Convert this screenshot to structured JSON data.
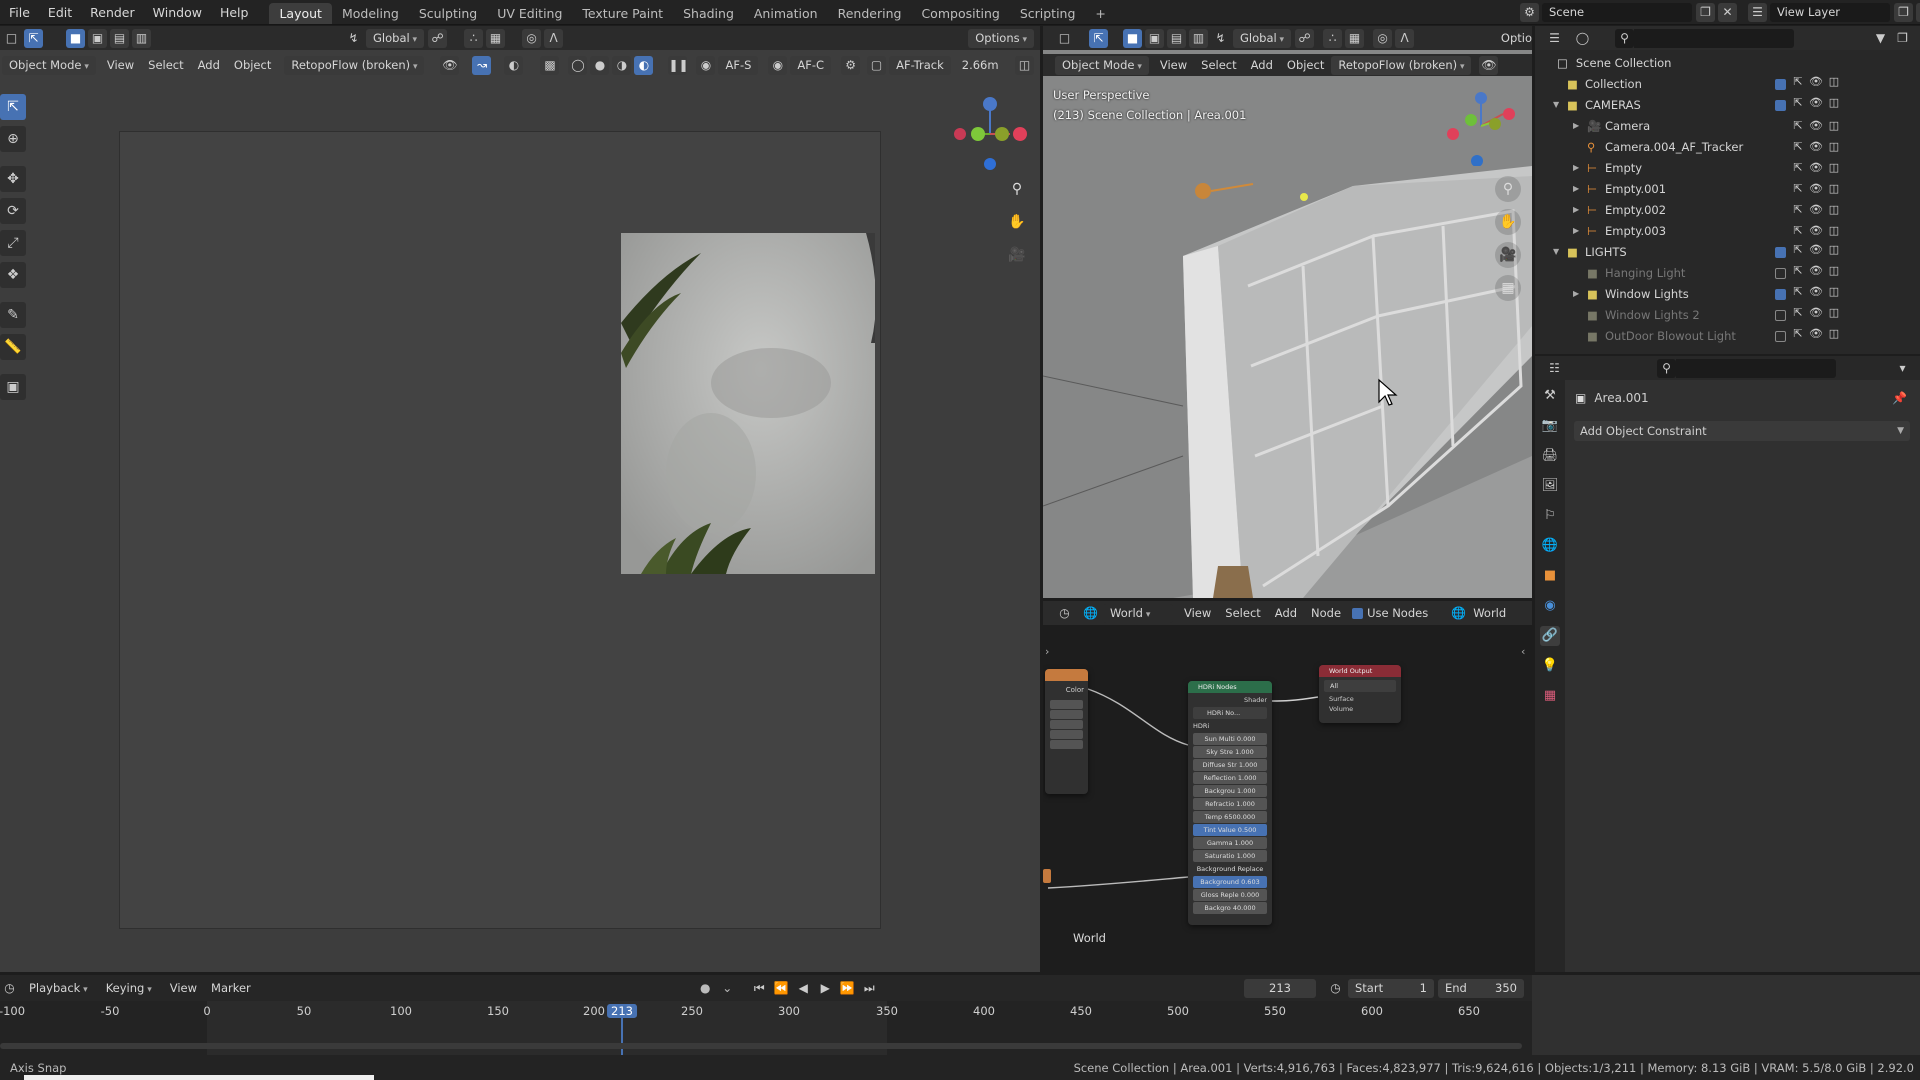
{
  "app": {
    "menu": [
      "File",
      "Edit",
      "Render",
      "Window",
      "Help"
    ],
    "workspaces": [
      "Layout",
      "Modeling",
      "Sculpting",
      "UV Editing",
      "Texture Paint",
      "Shading",
      "Animation",
      "Rendering",
      "Compositing",
      "Scripting"
    ],
    "active_workspace": "Layout",
    "add_workspace": "+",
    "scene_label": "Scene",
    "view_layer_label": "View Layer"
  },
  "left_viewport": {
    "mode": "Object Mode",
    "menus": [
      "View",
      "Select",
      "Add",
      "Object"
    ],
    "camera_preset": "RetopoFlow (broken)",
    "orientation": "Global",
    "options_label": "Options",
    "af_s": "AF-S",
    "af_c": "AF-C",
    "af_track": "AF-Track",
    "distance": "2.66m"
  },
  "right_viewport": {
    "mode": "Object Mode",
    "menus": [
      "View",
      "Select",
      "Add",
      "Object"
    ],
    "camera_preset": "RetopoFlow (broken)",
    "orientation": "Global",
    "options_label": "Optio",
    "view_name": "User Perspective",
    "view_context": "(213) Scene Collection | Area.001"
  },
  "node_editor": {
    "type": "World",
    "menus": [
      "View",
      "Select",
      "Add",
      "Node"
    ],
    "use_nodes_label": "Use Nodes",
    "world_label": "World",
    "footer_label": "World",
    "hdr_node": {
      "title": "HDRi Nodes",
      "output": "Shader",
      "image": "HDRi No...",
      "rows": [
        "HDRi",
        "Sun Multi 0.000",
        "Sky Stre 1.000",
        "Diffuse Str 1.000",
        "Reflection 1.000",
        "Backgrou 1.000",
        "Refractio 1.000",
        "Temp 6500.000",
        "Tint Value 0.500",
        "Gamma 1.000",
        "Saturatio 1.000",
        "Background Replace",
        "Background 0.603",
        "Gloss Reple 0.000",
        "Backgro 40.000"
      ]
    },
    "world_output": {
      "title": "World Output",
      "target": "All",
      "inputs": [
        "Surface",
        "Volume"
      ]
    },
    "left_node_socket": "Color"
  },
  "outliner": {
    "root": "Scene Collection",
    "rows": [
      {
        "label": "Collection",
        "depth": 1,
        "dim": false,
        "checkbox": true,
        "expand": false
      },
      {
        "label": "CAMERAS",
        "depth": 1,
        "dim": false,
        "checkbox": true,
        "expand": true
      },
      {
        "label": "Camera",
        "depth": 2,
        "dim": false,
        "checkbox": false,
        "expand": true
      },
      {
        "label": "Camera.004_AF_Tracker",
        "depth": 2,
        "dim": false,
        "checkbox": false,
        "expand": false
      },
      {
        "label": "Empty",
        "depth": 2,
        "dim": false,
        "checkbox": false,
        "expand": true
      },
      {
        "label": "Empty.001",
        "depth": 2,
        "dim": false,
        "checkbox": false,
        "expand": true
      },
      {
        "label": "Empty.002",
        "depth": 2,
        "dim": false,
        "checkbox": false,
        "expand": true
      },
      {
        "label": "Empty.003",
        "depth": 2,
        "dim": false,
        "checkbox": false,
        "expand": true
      },
      {
        "label": "LIGHTS",
        "depth": 1,
        "dim": false,
        "checkbox": true,
        "expand": true
      },
      {
        "label": "Hanging Light",
        "depth": 2,
        "dim": true,
        "checkbox": false,
        "expand": false
      },
      {
        "label": "Window Lights",
        "depth": 2,
        "dim": false,
        "checkbox": true,
        "expand": true
      },
      {
        "label": "Window Lights 2",
        "depth": 2,
        "dim": true,
        "checkbox": false,
        "expand": false
      },
      {
        "label": "OutDoor Blowout Light",
        "depth": 2,
        "dim": true,
        "checkbox": false,
        "expand": false
      }
    ]
  },
  "properties": {
    "object_name": "Area.001",
    "constraint_button": "Add Object Constraint"
  },
  "timeline": {
    "menus": [
      "Playback",
      "Keying",
      "View",
      "Marker"
    ],
    "current_frame": "213",
    "start_label": "Start",
    "start_value": "1",
    "end_label": "End",
    "end_value": "350",
    "ticks": [
      "-100",
      "-50",
      "0",
      "50",
      "100",
      "150",
      "200",
      "213",
      "250",
      "300",
      "350",
      "400",
      "450",
      "500",
      "550",
      "600",
      "650"
    ]
  },
  "statusbar": {
    "left": "Axis Snap",
    "right": "Scene Collection | Area.001 | Verts:4,916,763 | Faces:4,823,977 | Tris:9,624,616 | Objects:1/3,211 | Memory: 8.13 GiB | VRAM: 5.5/8.0 GiB | 2.92.0"
  }
}
